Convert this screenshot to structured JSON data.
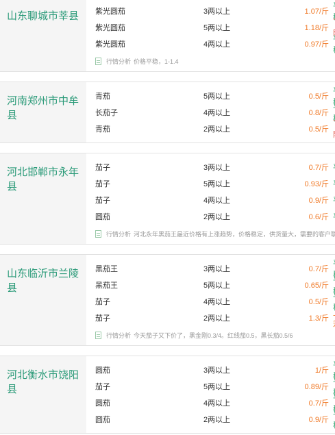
{
  "blocks": [
    {
      "location": "山东聊城市莘县",
      "rows": [
        {
          "name": "紫光圆茄",
          "spec": "3两以上",
          "price": "1.07/斤",
          "trend": "平稳",
          "trend_type": "stable"
        },
        {
          "name": "紫光圆茄",
          "spec": "5两以上",
          "price": "1.18/斤",
          "trend": "下降",
          "trend_type": "down"
        },
        {
          "name": "紫光圆茄",
          "spec": "4两以上",
          "price": "0.97/斤",
          "trend": "平稳",
          "trend_type": "stable"
        }
      ],
      "analysis_label": "行情分析",
      "analysis_text": "价格平稳，1-1.4"
    },
    {
      "location": "河南郑州市中牟县",
      "rows": [
        {
          "name": "青茄",
          "spec": "5两以上",
          "price": "0.5/斤",
          "trend": "平稳",
          "trend_type": "stable"
        },
        {
          "name": "长茄子",
          "spec": "4两以上",
          "price": "0.8/斤",
          "trend": "平稳",
          "trend_type": "stable"
        },
        {
          "name": "青茄",
          "spec": "2两以上",
          "price": "0.5/斤",
          "trend": "下降",
          "trend_type": "down"
        }
      ]
    },
    {
      "location": "河北邯郸市永年县",
      "rows": [
        {
          "name": "茄子",
          "spec": "3两以上",
          "price": "0.7/斤",
          "trend": "平稳",
          "trend_type": "stable"
        },
        {
          "name": "茄子",
          "spec": "5两以上",
          "price": "0.93/斤",
          "trend": "平稳",
          "trend_type": "stable"
        },
        {
          "name": "茄子",
          "spec": "4两以上",
          "price": "0.9/斤",
          "trend": "平稳",
          "trend_type": "stable"
        },
        {
          "name": "圆茄",
          "spec": "2两以上",
          "price": "0.6/斤",
          "trend": "平稳",
          "trend_type": "stable"
        }
      ],
      "analysis_label": "行情分析",
      "analysis_text": "河北永年黑茄王最近价格有上涨趋势，价格稳定，供货量大，需要的客户联系我"
    },
    {
      "location": "山东临沂市兰陵县",
      "rows": [
        {
          "name": "黑茄王",
          "spec": "3两以上",
          "price": "0.7/斤",
          "trend": "平稳",
          "trend_type": "stable"
        },
        {
          "name": "黑茄王",
          "spec": "5两以上",
          "price": "0.65/斤",
          "trend": "平稳",
          "trend_type": "stable"
        },
        {
          "name": "茄子",
          "spec": "4两以上",
          "price": "0.5/斤",
          "trend": "平稳",
          "trend_type": "stable"
        },
        {
          "name": "茄子",
          "spec": "2两以上",
          "price": "1.3/斤",
          "trend": "上升",
          "trend_type": "up"
        }
      ],
      "analysis_label": "行情分析",
      "analysis_text": "今天茄子又下价了，黑金刚0.3/4。红线茄0.5，黑长茄0.5/6"
    },
    {
      "location": "河北衡水市饶阳县",
      "rows": [
        {
          "name": "圆茄",
          "spec": "3两以上",
          "price": "1/斤",
          "trend": "平稳",
          "trend_type": "stable"
        },
        {
          "name": "茄子",
          "spec": "5两以上",
          "price": "0.89/斤",
          "trend": "平稳",
          "trend_type": "stable"
        },
        {
          "name": "圆茄",
          "spec": "4两以上",
          "price": "0.7/斤",
          "trend": "平稳",
          "trend_type": "stable"
        },
        {
          "name": "圆茄",
          "spec": "2两以上",
          "price": "0.9/斤",
          "trend": "平稳",
          "trend_type": "stable"
        }
      ]
    }
  ]
}
